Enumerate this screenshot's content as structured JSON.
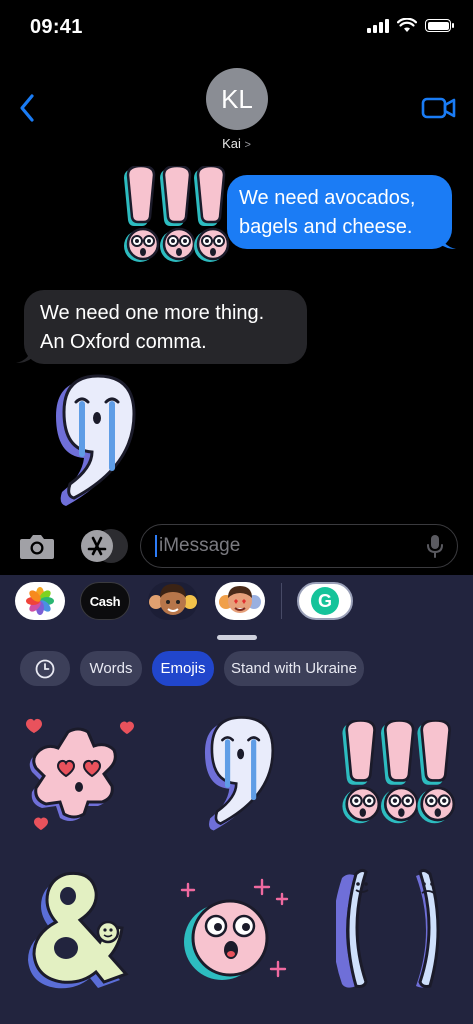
{
  "status_bar": {
    "time": "09:41"
  },
  "header": {
    "avatar_initials": "KL",
    "contact_name": "Kai",
    "contact_chevron": ">"
  },
  "messages": {
    "outgoing": {
      "line1": "We need avocados,",
      "line2": "bagels and cheese."
    },
    "incoming": {
      "line1": "We need one more thing.",
      "line2": "An Oxford comma."
    }
  },
  "input": {
    "placeholder": "iMessage"
  },
  "app_drawer": {
    "apps": [
      {
        "name": "photos-icon"
      },
      {
        "label": "Cash",
        "apple_glyph": ""
      },
      {
        "name": "memoji-icon"
      },
      {
        "name": "memoji-stickers-icon"
      },
      {
        "name": "grammarly-icon",
        "letter": "G"
      }
    ]
  },
  "sticker_categories": {
    "recent": "clock-icon",
    "items": [
      "Words",
      "Emojis",
      "Stand with Ukraine"
    ],
    "selected": "Emojis"
  },
  "stickers": [
    "heart-eyes-flower-sticker",
    "crying-comma-sticker",
    "exclamation-marks-sticker",
    "ampersand-sticker",
    "surprised-face-sticker",
    "parentheses-sticker"
  ],
  "colors": {
    "accent_blue": "#1b7cf5",
    "drawer_bg": "#22243e",
    "selected_chip": "#2146cc",
    "grammarly_green": "#15c39a"
  }
}
